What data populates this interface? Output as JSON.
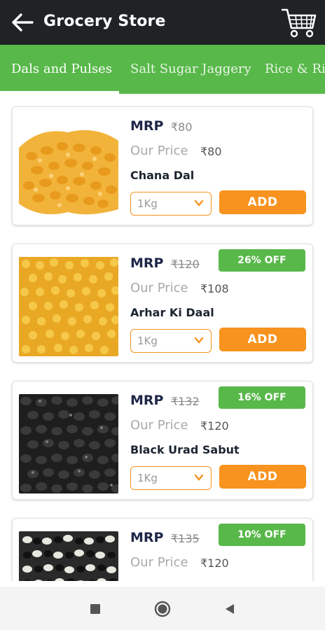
{
  "appbar": {
    "title": "Grocery Store",
    "back_icon": "arrow-left-icon",
    "cart_icon": "cart-icon"
  },
  "tabs": [
    {
      "label": "Dals and Pulses",
      "active": true
    },
    {
      "label": "Salt Sugar Jaggery",
      "active": false
    },
    {
      "label": "Rice & Ric",
      "active": false
    }
  ],
  "colors": {
    "appbar": "#1f2326",
    "tabs": "#58b84a",
    "accent": "#f7931e",
    "badge": "#58b84a"
  },
  "products": [
    {
      "mrp_label": "MRP",
      "mrp": "₹80",
      "mrp_struck": false,
      "our_price_label": "Our Price",
      "our_price": "₹80",
      "name": "Chana Dal",
      "badge": "",
      "qty": "1Kg",
      "add_label": "ADD"
    },
    {
      "mrp_label": "MRP",
      "mrp": "₹120",
      "mrp_struck": true,
      "our_price_label": "Our Price",
      "our_price": "₹108",
      "name": "Arhar Ki Daal",
      "badge": "26% OFF",
      "qty": "1Kg",
      "add_label": "ADD"
    },
    {
      "mrp_label": "MRP",
      "mrp": "₹132",
      "mrp_struck": true,
      "our_price_label": "Our Price",
      "our_price": "₹120",
      "name": "Black Urad Sabut",
      "badge": "16% OFF",
      "qty": "1Kg",
      "add_label": "ADD"
    },
    {
      "mrp_label": "MRP",
      "mrp": "₹135",
      "mrp_struck": true,
      "our_price_label": "Our Price",
      "our_price": "₹120",
      "name": "",
      "badge": "10% OFF",
      "qty": "",
      "add_label": ""
    }
  ],
  "navbar": {
    "recents_icon": "square-icon",
    "home_icon": "circle-icon",
    "back_icon": "triangle-back-icon"
  }
}
